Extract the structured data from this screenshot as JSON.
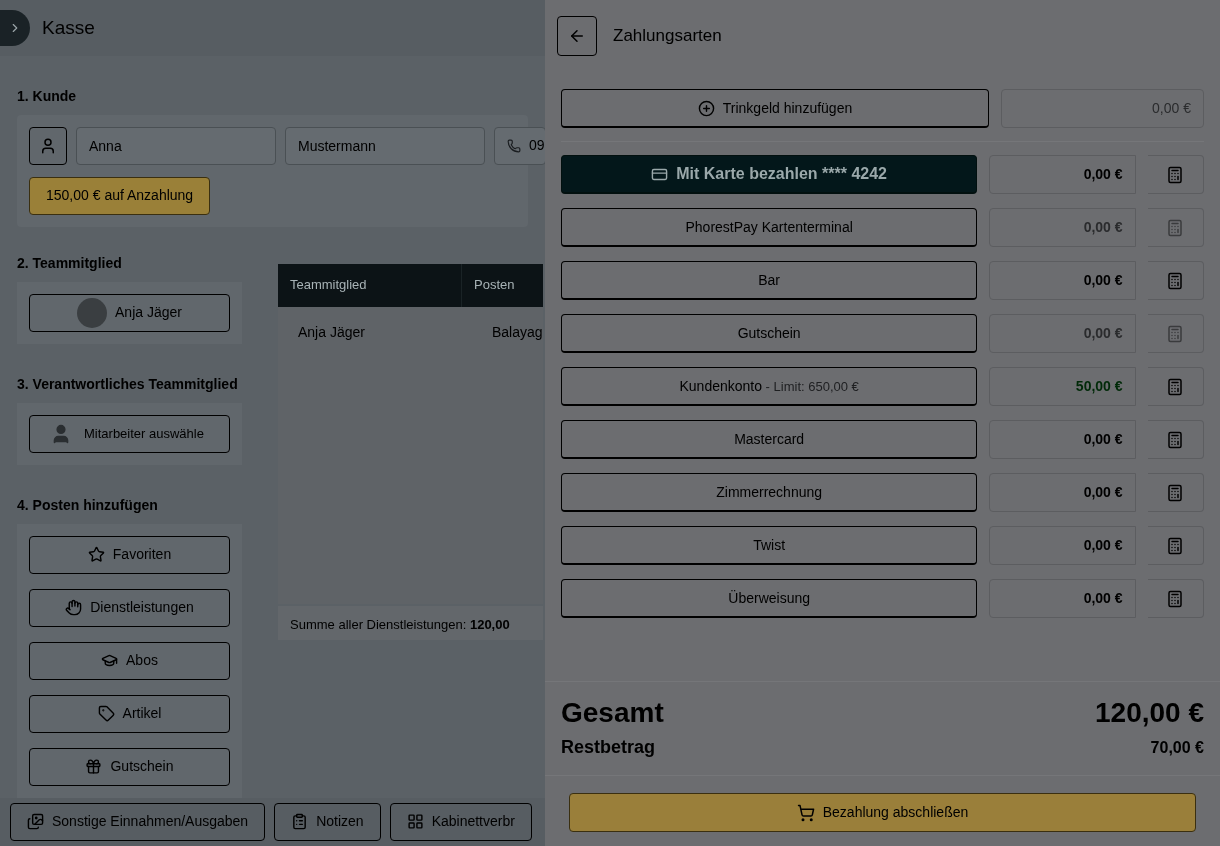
{
  "header": {
    "title": "Kasse"
  },
  "customer": {
    "heading": "1. Kunde",
    "first_name": "Anna",
    "last_name": "Mustermann",
    "phone": "09",
    "deposit_badge": "150,00 € auf Anzahlung"
  },
  "team": {
    "heading": "2. Teammitglied",
    "member": "Anja Jäger"
  },
  "responsible": {
    "heading": "3. Verantwortliches Teammitglied",
    "button": "Mitarbeiter auswähle"
  },
  "items": {
    "heading": "4. Posten hinzufügen",
    "buttons": [
      {
        "label": "Favoriten",
        "kind": "star"
      },
      {
        "label": "Dienstleistungen",
        "kind": "hand"
      },
      {
        "label": "Abos",
        "kind": "cap"
      },
      {
        "label": "Artikel",
        "kind": "tag"
      },
      {
        "label": "Gutschein",
        "kind": "gift"
      }
    ]
  },
  "table": {
    "columns": [
      "Teammitglied",
      "Posten"
    ],
    "rows": [
      [
        "Anja Jäger",
        "Balayag"
      ]
    ],
    "sum": "Summe aller Dienstleistungen: **120,00**"
  },
  "footer_buttons": [
    {
      "label": "Sonstige Einnahmen/Ausgaben",
      "kind": "images"
    },
    {
      "label": "Notizen",
      "kind": "clipboard"
    },
    {
      "label": "Kabinettverbr",
      "kind": "grid"
    }
  ],
  "drawer": {
    "title": "Zahlungsarten",
    "tip": {
      "label": "Trinkgeld hinzufügen",
      "amount": "0,00 €",
      "disabled": true
    },
    "payments": [
      {
        "label": "Mit Karte bezahlen **** 4242",
        "kind": "card",
        "amount": "0,00 €",
        "disabled": false,
        "credited": false
      },
      {
        "label": "PhorestPay Kartenterminal",
        "kind": "plain",
        "amount": "0,00 €",
        "disabled": true,
        "credited": false
      },
      {
        "label": "Bar",
        "kind": "plain",
        "amount": "0,00 €",
        "disabled": false,
        "credited": false
      },
      {
        "label": "Gutschein",
        "kind": "plain",
        "amount": "0,00 €",
        "disabled": true,
        "credited": false
      },
      {
        "label": "Kundenkonto",
        "sublabel": "- Limit: 650,00 €",
        "kind": "plain",
        "amount": "50,00 €",
        "disabled": false,
        "credited": true
      },
      {
        "label": "Mastercard",
        "kind": "plain",
        "amount": "0,00 €",
        "disabled": false,
        "credited": false
      },
      {
        "label": "Zimmerrechnung",
        "kind": "plain",
        "amount": "0,00 €",
        "disabled": false,
        "credited": false
      },
      {
        "label": "Twist",
        "kind": "plain",
        "amount": "0,00 €",
        "disabled": false,
        "credited": false
      },
      {
        "label": "Überweisung",
        "kind": "plain",
        "amount": "0,00 €",
        "disabled": false,
        "credited": false
      }
    ],
    "total_label": "Gesamt",
    "total": "120,00 €",
    "rest_label": "Restbetrag",
    "rest": "70,00 €",
    "checkout": "Bezahlung abschließen"
  }
}
